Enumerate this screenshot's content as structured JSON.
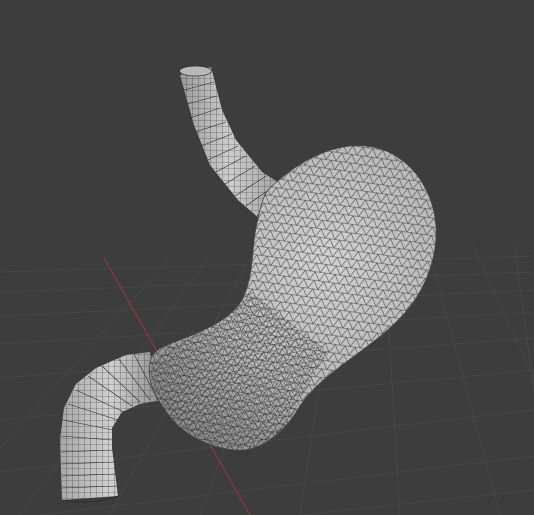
{
  "viewport": {
    "background": "#3d3d3d",
    "grid_line_color": "#474747",
    "x_axis_color": "#8a3a40",
    "mesh_fill_light": "#c8c8c8",
    "mesh_fill_dark": "#8d8d8d",
    "wire_color": "#2a2a2a"
  },
  "object": {
    "icon": "stomach-mesh-icon",
    "display_mode": "wireframe-over-solid"
  }
}
